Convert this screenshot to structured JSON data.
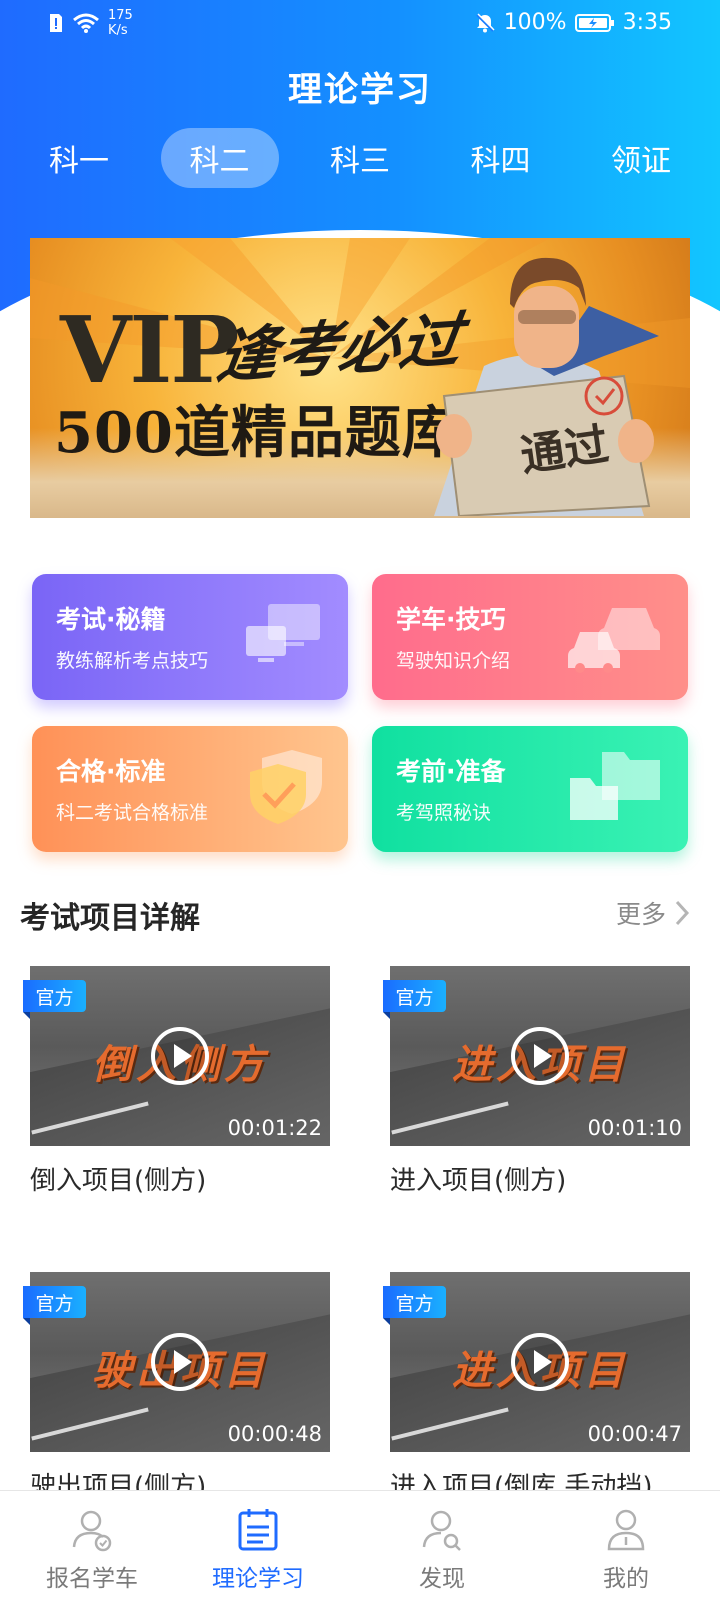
{
  "status_bar": {
    "speed_value": "175",
    "speed_unit": "K/s",
    "battery": "100%",
    "time": "3:35"
  },
  "header": {
    "title": "理论学习",
    "tabs": [
      {
        "label": "科一",
        "active": false
      },
      {
        "label": "科二",
        "active": true
      },
      {
        "label": "科三",
        "active": false
      },
      {
        "label": "科四",
        "active": false
      },
      {
        "label": "领证",
        "active": false
      }
    ]
  },
  "banner": {
    "vip": "VIP",
    "slogan": "逢考必过",
    "headline": "500道精品题库",
    "paper_text": "通过"
  },
  "cards": [
    {
      "title": "考试·秘籍",
      "subtitle": "教练解析考点技巧",
      "icon": "computer-icon"
    },
    {
      "title": "学车·技巧",
      "subtitle": "驾驶知识介绍",
      "icon": "cars-icon"
    },
    {
      "title": "合格·标准",
      "subtitle": "科二考试合格标准",
      "icon": "shield-check-icon"
    },
    {
      "title": "考前·准备",
      "subtitle": "考驾照秘诀",
      "icon": "folders-icon"
    }
  ],
  "section": {
    "title": "考试项目详解",
    "more": "更多"
  },
  "videos": [
    {
      "badge": "官方",
      "thumb_text": "倒入侧方",
      "duration": "00:01:22",
      "title": "倒入项目(侧方)"
    },
    {
      "badge": "官方",
      "thumb_text": "进入项目",
      "duration": "00:01:10",
      "title": "进入项目(侧方)"
    },
    {
      "badge": "官方",
      "thumb_text": "驶出项目",
      "duration": "00:00:48",
      "title": "驶出项目(侧方)"
    },
    {
      "badge": "官方",
      "thumb_text": "进入项目",
      "duration": "00:00:47",
      "title": "进入项目(倒库,手动挡)"
    }
  ],
  "bottom_nav": [
    {
      "label": "报名学车",
      "icon": "user-check-icon",
      "active": false
    },
    {
      "label": "理论学习",
      "icon": "calendar-list-icon",
      "active": true
    },
    {
      "label": "发现",
      "icon": "user-search-icon",
      "active": false
    },
    {
      "label": "我的",
      "icon": "person-icon",
      "active": false
    }
  ],
  "colors": {
    "brand_blue": "#1f6bff",
    "header_gradient_end": "#12c6ff"
  }
}
